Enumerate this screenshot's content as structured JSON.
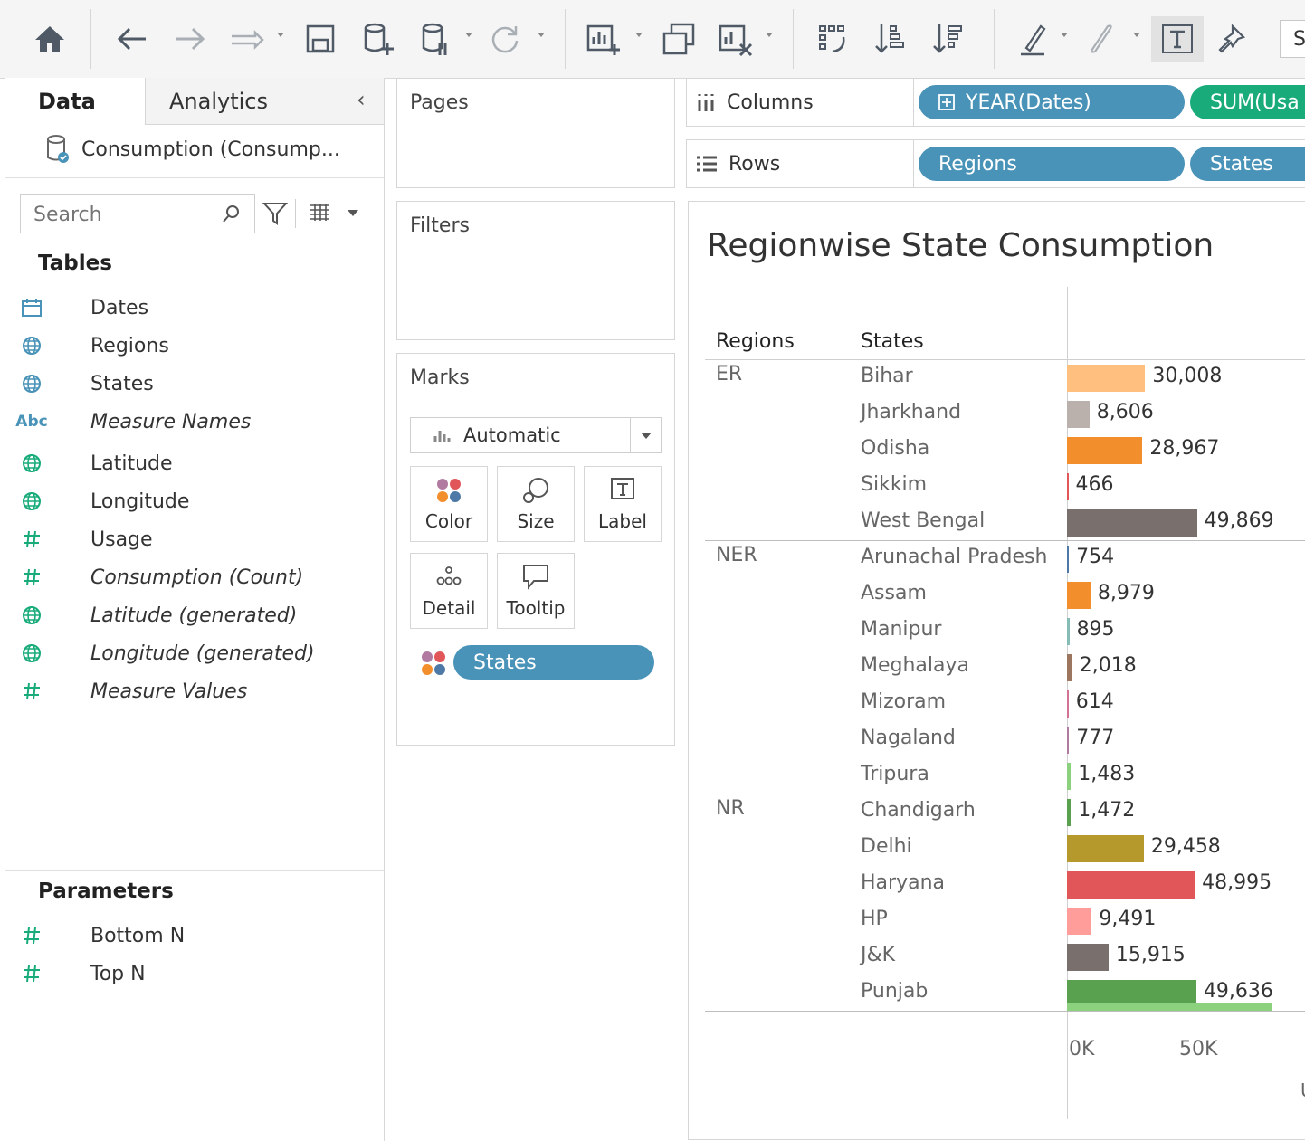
{
  "toolbar": {
    "icons": [
      "home-icon",
      "back-icon",
      "forward-icon",
      "redo-icon",
      "save-icon",
      "new-datasource-icon",
      "pause-updates-icon",
      "refresh-icon",
      "new-worksheet-icon",
      "duplicate-sheet-icon",
      "clear-sheet-icon",
      "swap-icon",
      "sort-ascending-icon",
      "sort-descending-icon",
      "highlight-icon",
      "group-icon",
      "text-label-icon",
      "pin-icon"
    ],
    "show_me": "S"
  },
  "left_pane": {
    "tab_data": "Data",
    "tab_analytics": "Analytics",
    "datasource": "Consumption (Consump...",
    "search_placeholder": "Search",
    "tables_title": "Tables",
    "fields": [
      {
        "label": "Dates",
        "icon": "calendar-icon",
        "italic": false
      },
      {
        "label": "Regions",
        "icon": "globe-icon",
        "italic": false
      },
      {
        "label": "States",
        "icon": "globe-icon",
        "italic": false
      },
      {
        "label": "Measure Names",
        "icon": "abc-icon",
        "italic": true
      }
    ],
    "measures": [
      {
        "label": "Latitude",
        "icon": "globe-green-icon",
        "italic": false
      },
      {
        "label": "Longitude",
        "icon": "globe-green-icon",
        "italic": false
      },
      {
        "label": "Usage",
        "icon": "hash-icon",
        "italic": false
      },
      {
        "label": "Consumption (Count)",
        "icon": "hash-icon",
        "italic": true
      },
      {
        "label": "Latitude (generated)",
        "icon": "globe-green-icon",
        "italic": true
      },
      {
        "label": "Longitude (generated)",
        "icon": "globe-green-icon",
        "italic": true
      },
      {
        "label": "Measure Values",
        "icon": "hash-icon",
        "italic": true
      }
    ],
    "parameters_title": "Parameters",
    "parameters": [
      "Bottom N",
      "Top N"
    ]
  },
  "cards": {
    "pages": "Pages",
    "filters": "Filters",
    "marks": "Marks",
    "mark_type": "Automatic",
    "buttons": [
      "Color",
      "Size",
      "Label",
      "Detail",
      "Tooltip"
    ],
    "marks_pill": "States"
  },
  "shelves": {
    "columns_label": "Columns",
    "rows_label": "Rows",
    "columns_pills": [
      "YEAR(Dates)",
      "SUM(Usa"
    ],
    "rows_pills": [
      "Regions",
      "States"
    ]
  },
  "chart_data": {
    "type": "bar",
    "title": "Regionwise State Consumption",
    "header_regions": "Regions",
    "header_states": "States",
    "x_ticks": [
      "0K",
      "50K"
    ],
    "x_axis_label_partial": "U",
    "groups": [
      {
        "region": "ER",
        "rows": [
          {
            "state": "Bihar",
            "value": 30008,
            "label": "30,008",
            "color": "#ffbf7f"
          },
          {
            "state": "Jharkhand",
            "value": 8606,
            "label": "8,606",
            "color": "#bab0ac"
          },
          {
            "state": "Odisha",
            "value": 28967,
            "label": "28,967",
            "color": "#f28e2b"
          },
          {
            "state": "Sikkim",
            "value": 466,
            "label": "466",
            "color": "#e15759"
          },
          {
            "state": "West Bengal",
            "value": 49869,
            "label": "49,869",
            "color": "#79706e"
          }
        ]
      },
      {
        "region": "NER",
        "rows": [
          {
            "state": "Arunachal Pradesh",
            "value": 754,
            "label": "754",
            "color": "#4e79a7"
          },
          {
            "state": "Assam",
            "value": 8979,
            "label": "8,979",
            "color": "#f28e2b"
          },
          {
            "state": "Manipur",
            "value": 895,
            "label": "895",
            "color": "#86bcb6"
          },
          {
            "state": "Meghalaya",
            "value": 2018,
            "label": "2,018",
            "color": "#9d7660"
          },
          {
            "state": "Mizoram",
            "value": 614,
            "label": "614",
            "color": "#d37295"
          },
          {
            "state": "Nagaland",
            "value": 777,
            "label": "777",
            "color": "#b07aa1"
          },
          {
            "state": "Tripura",
            "value": 1483,
            "label": "1,483",
            "color": "#8cd17d"
          }
        ]
      },
      {
        "region": "NR",
        "rows": [
          {
            "state": "Chandigarh",
            "value": 1472,
            "label": "1,472",
            "color": "#59a14f"
          },
          {
            "state": "Delhi",
            "value": 29458,
            "label": "29,458",
            "color": "#b6992d"
          },
          {
            "state": "Haryana",
            "value": 48995,
            "label": "48,995",
            "color": "#e15759"
          },
          {
            "state": "HP",
            "value": 9491,
            "label": "9,491",
            "color": "#ff9d9a"
          },
          {
            "state": "J&K",
            "value": 15915,
            "label": "15,915",
            "color": "#79706e"
          },
          {
            "state": "Punjab",
            "value": 49636,
            "label": "49,636",
            "color": "#59a14f"
          }
        ]
      }
    ],
    "xlim": [
      0,
      100000
    ]
  }
}
